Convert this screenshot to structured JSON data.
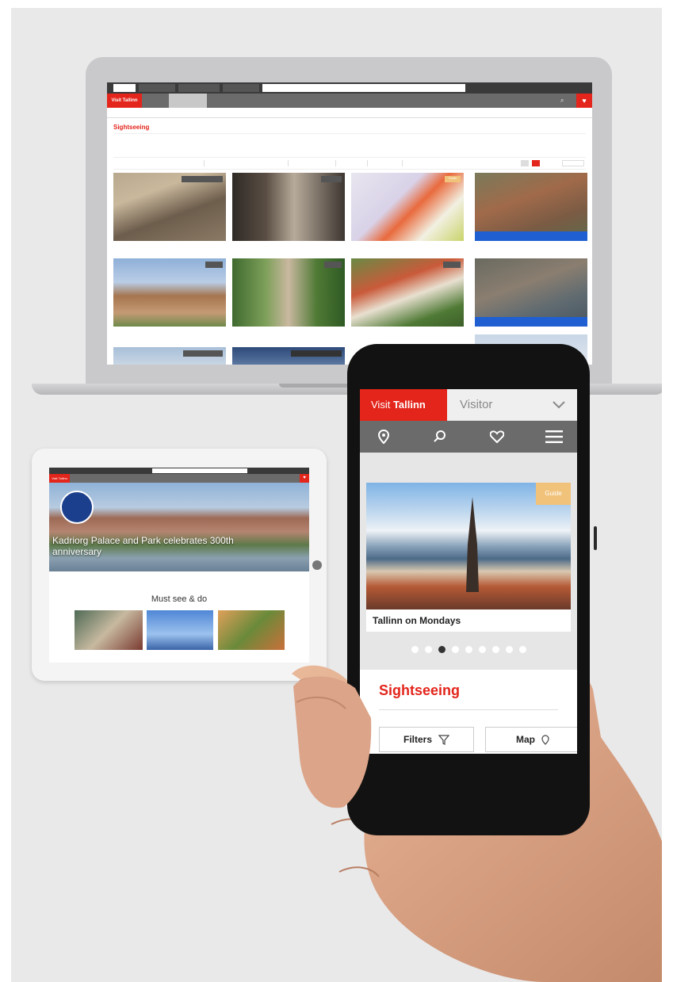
{
  "laptop": {
    "topbar_tabs": [
      "",
      "",
      "",
      ""
    ],
    "nav": {
      "logo": "Visit Tallinn",
      "items": [
        "",
        "",
        "",
        "",
        ""
      ],
      "heart_icon": "heart-icon"
    },
    "subnav_items": [
      "",
      "",
      "",
      "",
      "",
      ""
    ],
    "page_title": "Sightseeing",
    "filters": [
      "",
      "",
      "",
      "",
      "",
      ""
    ],
    "cards": [
      {
        "caption": "",
        "tag": ""
      },
      {
        "caption": "",
        "tag": ""
      },
      {
        "caption": "",
        "tag": "Guide"
      },
      {
        "caption": "",
        "tag": ""
      },
      {
        "caption": "",
        "tag": ""
      },
      {
        "caption": "",
        "tag": ""
      },
      {
        "caption": "",
        "tag": ""
      },
      {
        "caption": "",
        "tag": ""
      },
      {
        "caption": "",
        "tag": ""
      }
    ]
  },
  "tablet": {
    "logo": "Visit Tallinn",
    "hero_title": "Kadriorg Palace and Park celebrates 300th anniversary",
    "section_title": "Must see & do",
    "cards": [
      "",
      "",
      ""
    ]
  },
  "phone": {
    "logo_prefix": "Visit",
    "logo_brand": "Tallinn",
    "audience_select": "Visitor",
    "icons": [
      "map-pin-icon",
      "search-icon",
      "heart-icon",
      "menu-icon"
    ],
    "hero_tag": "Guide",
    "hero_caption": "Tallinn on Mondays",
    "carousel_active": 3,
    "carousel_count": 9,
    "section_title": "Sightseeing",
    "filters_button": "Filters",
    "map_button": "Map"
  },
  "colors": {
    "brand_red": "#e3251b",
    "nav_grey": "#6b6b6b",
    "guide_tag": "#f0c27a",
    "link_blue": "#1f5fd1"
  }
}
